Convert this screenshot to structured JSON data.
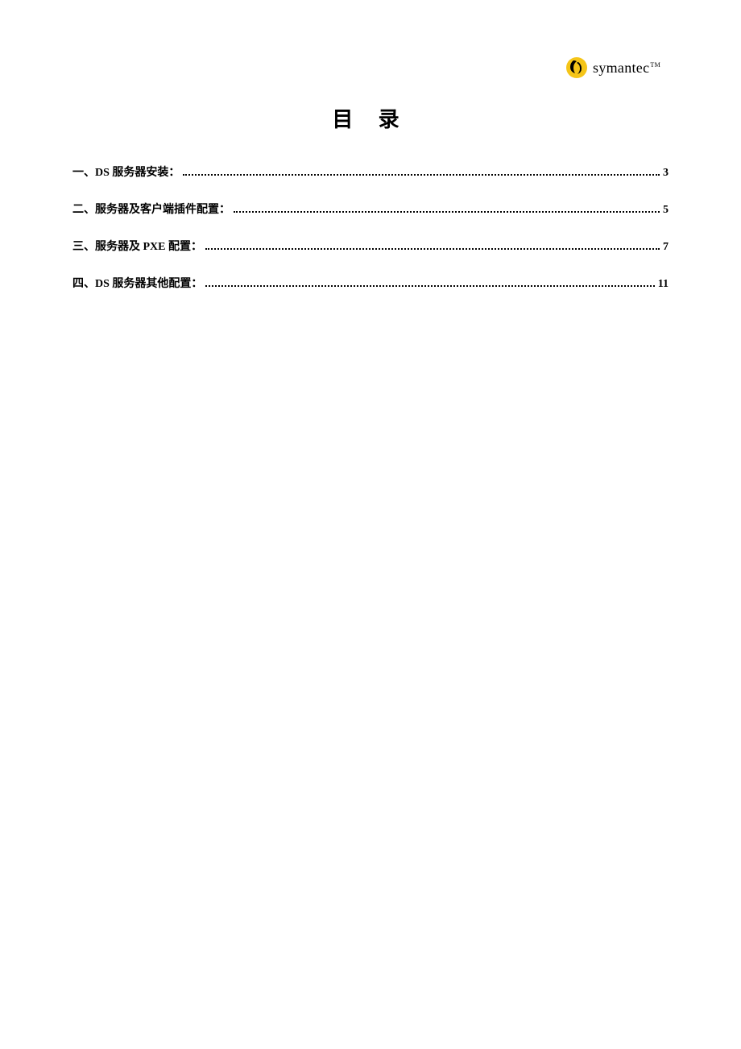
{
  "logo": {
    "text": "symantec",
    "tm": "TM"
  },
  "title": "目 录",
  "toc": {
    "entries": [
      {
        "label": "一、DS 服务器安装：",
        "page": "3"
      },
      {
        "label": "二、服务器及客户端插件配置：",
        "page": "5"
      },
      {
        "label": "三、服务器及 PXE 配置：",
        "page": "7"
      },
      {
        "label": "四、DS 服务器其他配置：",
        "page": "11"
      }
    ]
  }
}
